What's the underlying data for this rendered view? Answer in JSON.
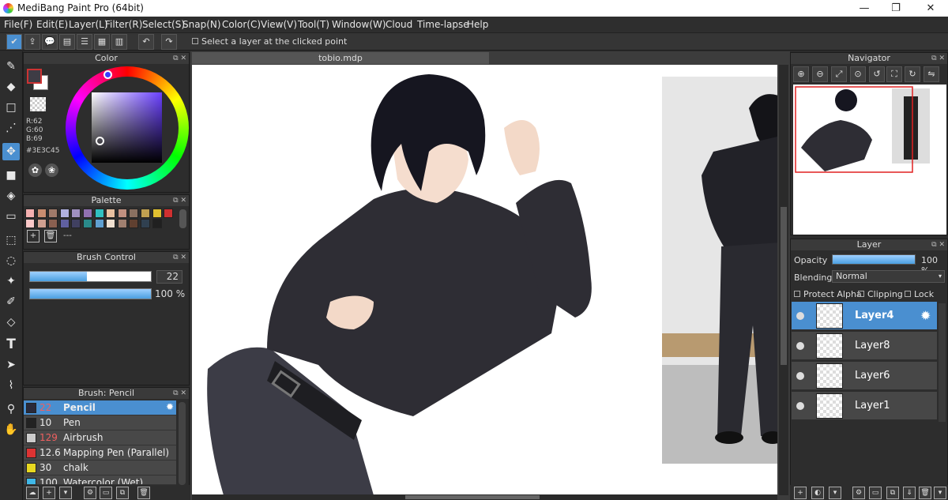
{
  "window": {
    "title": "MediBang Paint Pro (64bit)",
    "minimize": "—",
    "maximize": "❐",
    "close": "✕"
  },
  "menu": [
    "File(F)",
    "Edit(E)",
    "Layer(L)",
    "Filter(R)",
    "Select(S)",
    "Snap(N)",
    "Color(C)",
    "View(V)",
    "Tool(T)",
    "Window(W)",
    "Cloud",
    "Time-lapse",
    "Help"
  ],
  "toolbar": {
    "hint": "Select a layer at the clicked point"
  },
  "color_panel": {
    "title": "Color",
    "r": "R:62",
    "g": "G:60",
    "b": "B:69",
    "hex": "#3E3C45",
    "fg": "#3E3C45"
  },
  "palette_panel": {
    "title": "Palette",
    "dash": "---",
    "colors": [
      "#f4b0b0",
      "#c98d70",
      "#a07a6a",
      "#b0b0e0",
      "#a090c0",
      "#9070b0",
      "#30c0c0",
      "#e8c0a0",
      "#c09080",
      "#8a7060",
      "#c0a050",
      "#e0c030",
      "#d03030",
      "#fbc8c8",
      "#d0a090",
      "#8a6050",
      "#6060a0",
      "#404060",
      "#2a8a8a",
      "#60a0d0",
      "#f0e0d0",
      "#a08070",
      "#604030",
      "#304050",
      "#202020"
    ]
  },
  "brush_control": {
    "title": "Brush Control",
    "size": "22",
    "opacity": "100 %",
    "size_fraction": 0.47,
    "opacity_fraction": 1.0
  },
  "brush_panel": {
    "title": "Brush: Pencil",
    "items": [
      {
        "size": "22",
        "name": "Pencil",
        "color": "#2a2a3a"
      },
      {
        "size": "10",
        "name": "Pen",
        "color": "#222222"
      },
      {
        "size": "129",
        "name": "Airbrush",
        "color": "#cccccc"
      },
      {
        "size": "12.6",
        "name": "Mapping Pen (Parallel)",
        "color": "#dd3333"
      },
      {
        "size": "30",
        "name": "chalk",
        "color": "#e8d820"
      },
      {
        "size": "100",
        "name": "Watercolor (Wet)",
        "color": "#40b8e8"
      }
    ]
  },
  "canvas": {
    "tab": "tobio.mdp"
  },
  "navigator": {
    "title": "Navigator"
  },
  "layer_panel": {
    "title": "Layer",
    "opacity_label": "Opacity",
    "opacity_value": "100 %",
    "blending_label": "Blending",
    "blending_value": "Normal",
    "protect_alpha": "Protect Alpha",
    "clipping": "Clipping",
    "lock": "Lock",
    "layers": [
      "Layer4",
      "Layer8",
      "Layer6",
      "Layer1"
    ]
  }
}
